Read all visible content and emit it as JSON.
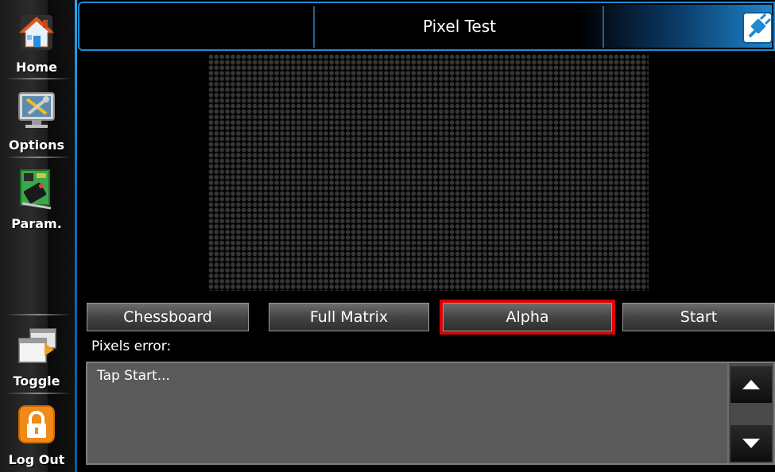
{
  "sidebar": {
    "items": [
      {
        "label": "Home",
        "icon": "home-icon"
      },
      {
        "label": "Options",
        "icon": "tools-icon"
      },
      {
        "label": "Param.",
        "icon": "circuit-board-icon"
      },
      {
        "label": "Toggle",
        "icon": "toggle-windows-icon"
      },
      {
        "label": "Log Out",
        "icon": "lock-icon"
      }
    ]
  },
  "header": {
    "title": "Pixel Test",
    "exit_icon": "plug-exit-icon"
  },
  "matrix": {
    "icon": "pixel-dot-matrix"
  },
  "actions": {
    "chessboard": "Chessboard",
    "full_matrix": "Full Matrix",
    "alpha": "Alpha",
    "start": "Start",
    "selected": "Alpha"
  },
  "error_panel": {
    "label": "Pixels error:",
    "text": "Tap Start...",
    "scroll_up_icon": "arrow-up-icon",
    "scroll_down_icon": "arrow-down-icon"
  },
  "colors": {
    "accent": "#1f8ad2",
    "selection": "#e00000",
    "panel": "#5a5a5a"
  }
}
